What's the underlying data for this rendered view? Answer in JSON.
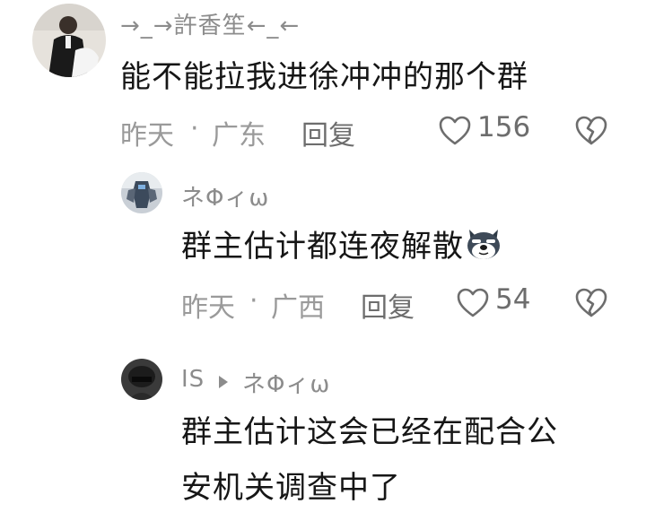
{
  "comments": [
    {
      "username": "→_→許香笙←_←",
      "text": "能不能拉我进徐冲冲的那个群",
      "time": "昨天",
      "separator": "·",
      "location": "广东",
      "reply_label": "回复",
      "likes": "156"
    },
    {
      "username": "ネΦィω",
      "text": "群主估计都连夜解散",
      "emoji": "dog-emoji",
      "time": "昨天",
      "separator": "·",
      "location": "广西",
      "reply_label": "回复",
      "likes": "54"
    },
    {
      "username": "IS",
      "reply_to": "ネΦィω",
      "text_lines": [
        "群主估计这会已经在配合公",
        "安机关调查中了"
      ]
    }
  ]
}
